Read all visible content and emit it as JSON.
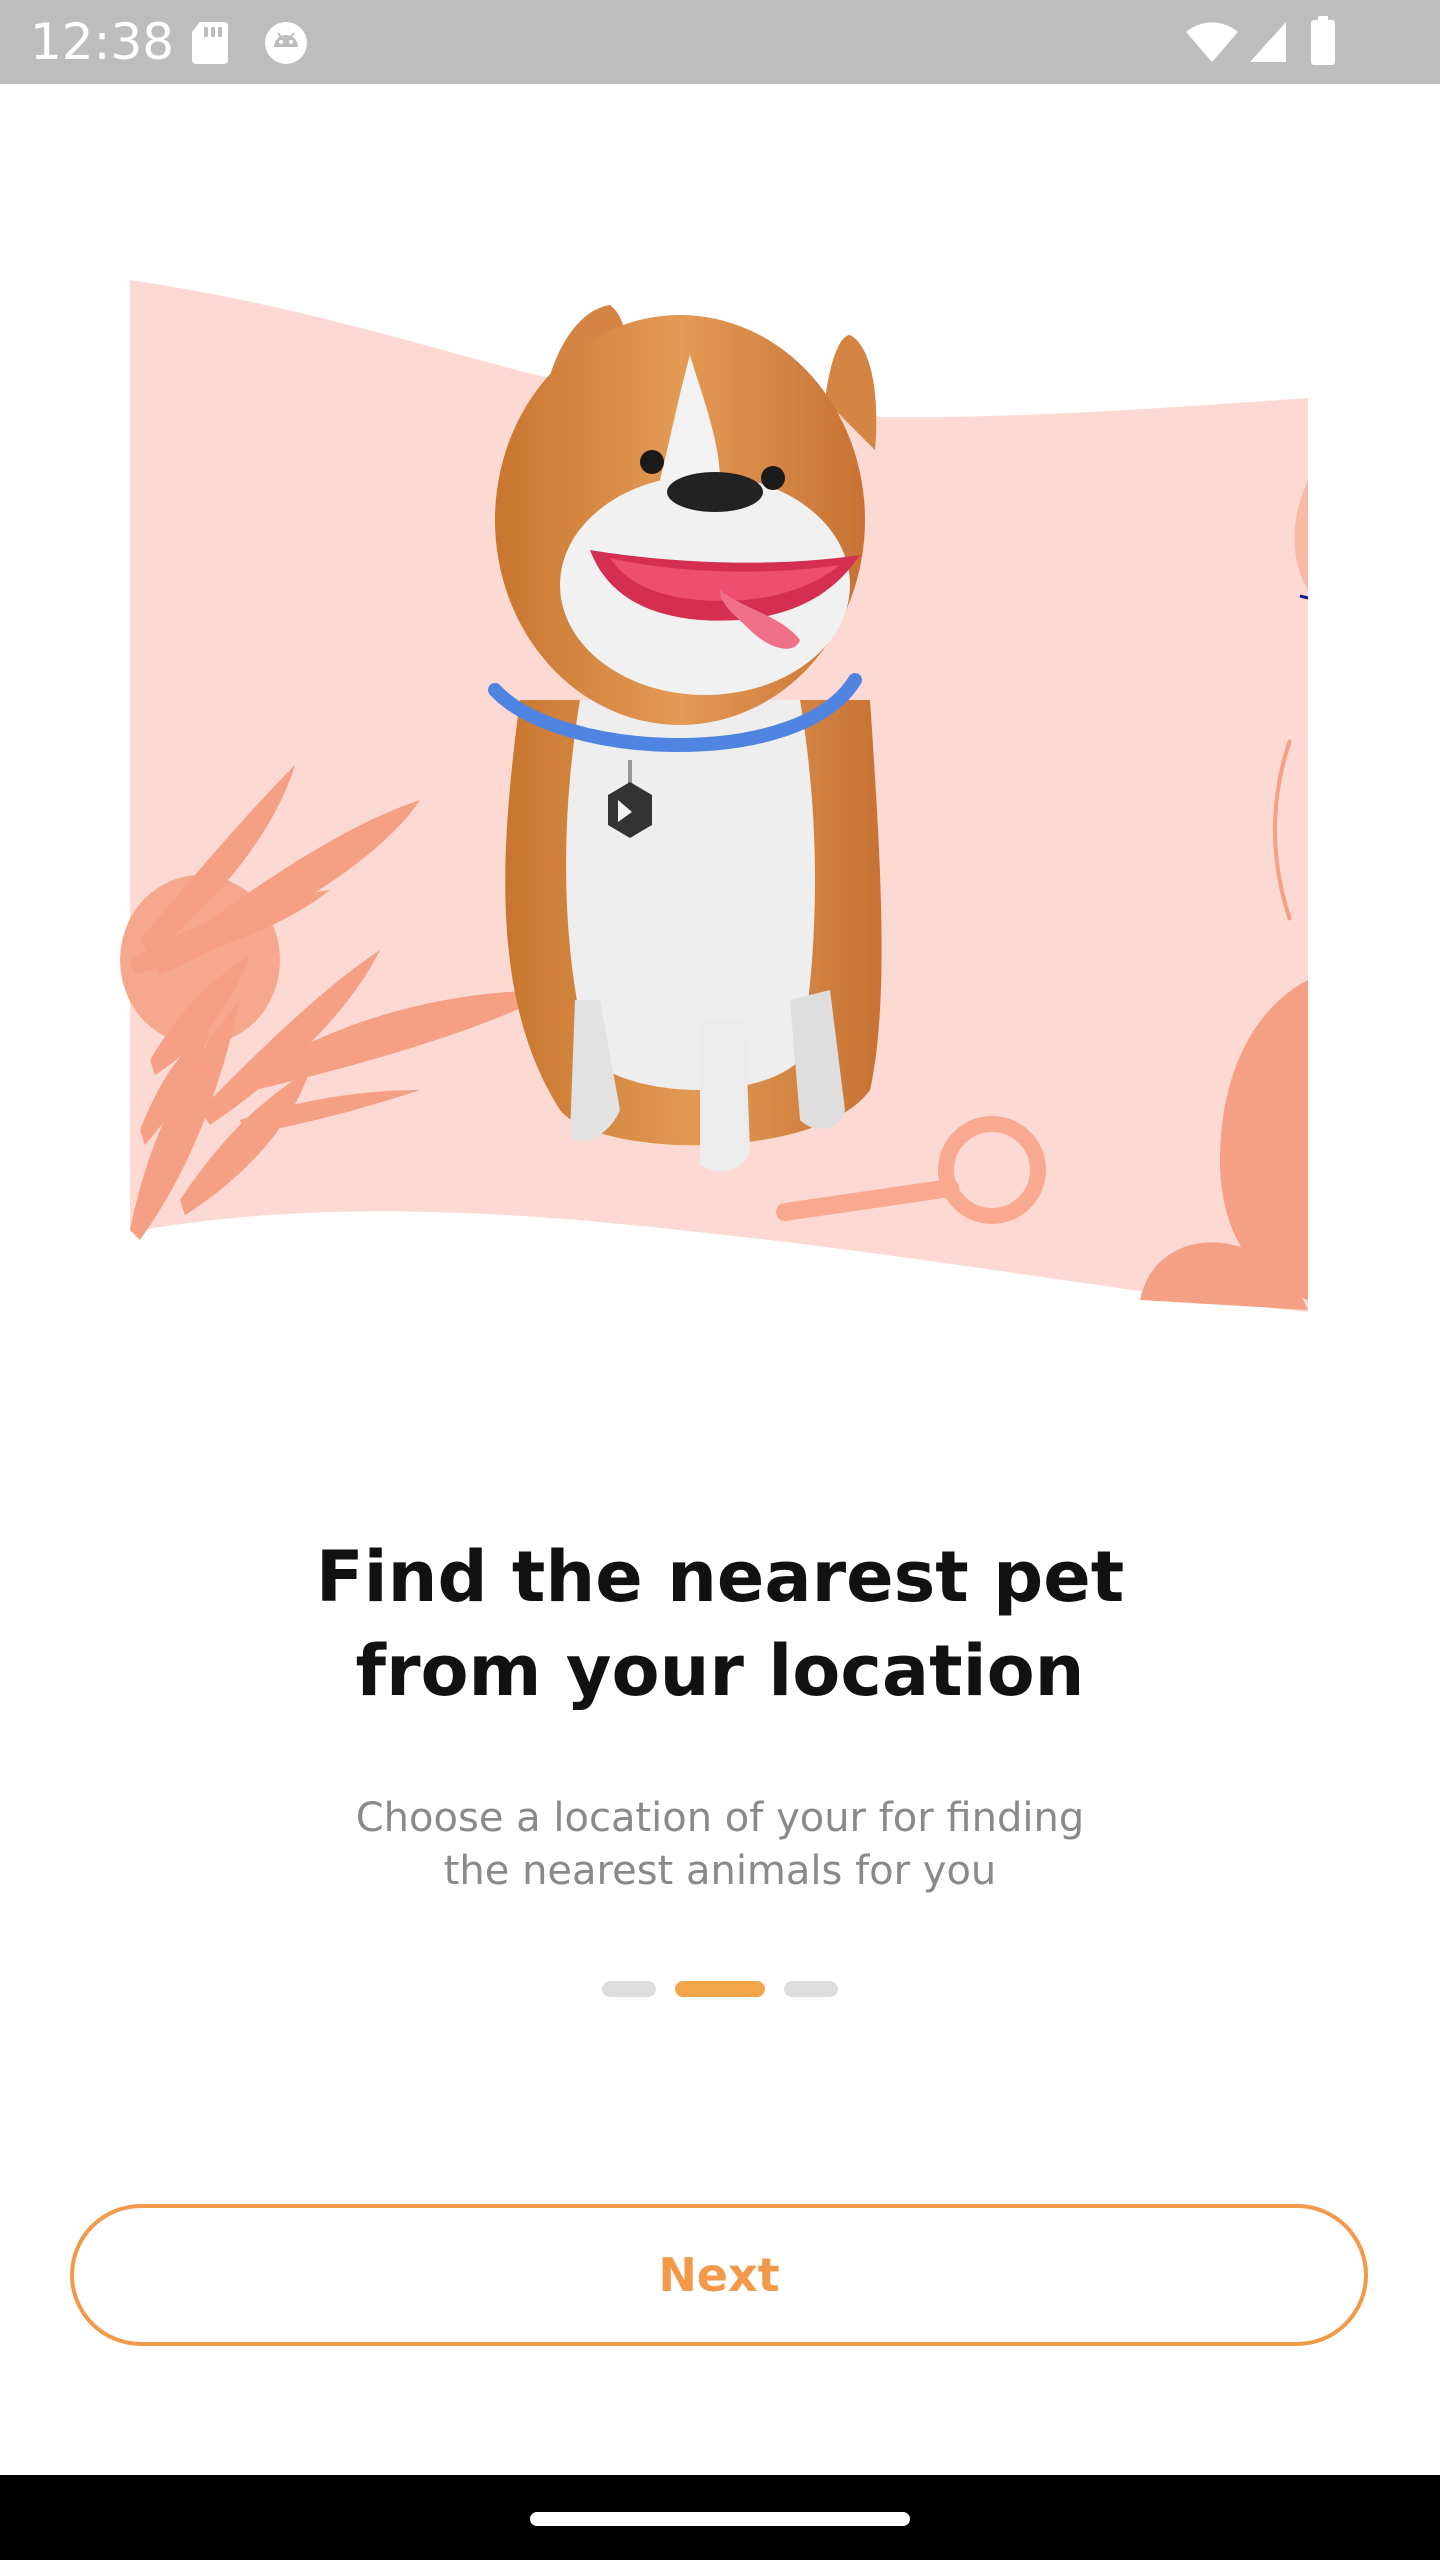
{
  "status_bar": {
    "time": "12:38",
    "left_icons": [
      "sd-card-icon",
      "android-debug-icon"
    ],
    "right_icons": [
      "wifi-icon",
      "cell-signal-icon",
      "battery-icon"
    ]
  },
  "onboarding": {
    "illustration": "dog-with-collar-illustration",
    "title_line1": "Find the nearest pet",
    "title_line2": "from your location",
    "subtitle_line1": "Choose a location of your for finding",
    "subtitle_line2": "the nearest animals for you",
    "pager": {
      "page_count": 3,
      "active_index": 1
    },
    "next_label": "Next"
  },
  "colors": {
    "accent": "#f29a4a",
    "pager_active": "#f2a549",
    "pager_inactive": "#dddddd",
    "illustration_bg": "#fcdad3",
    "leaf": "#f59f84"
  }
}
